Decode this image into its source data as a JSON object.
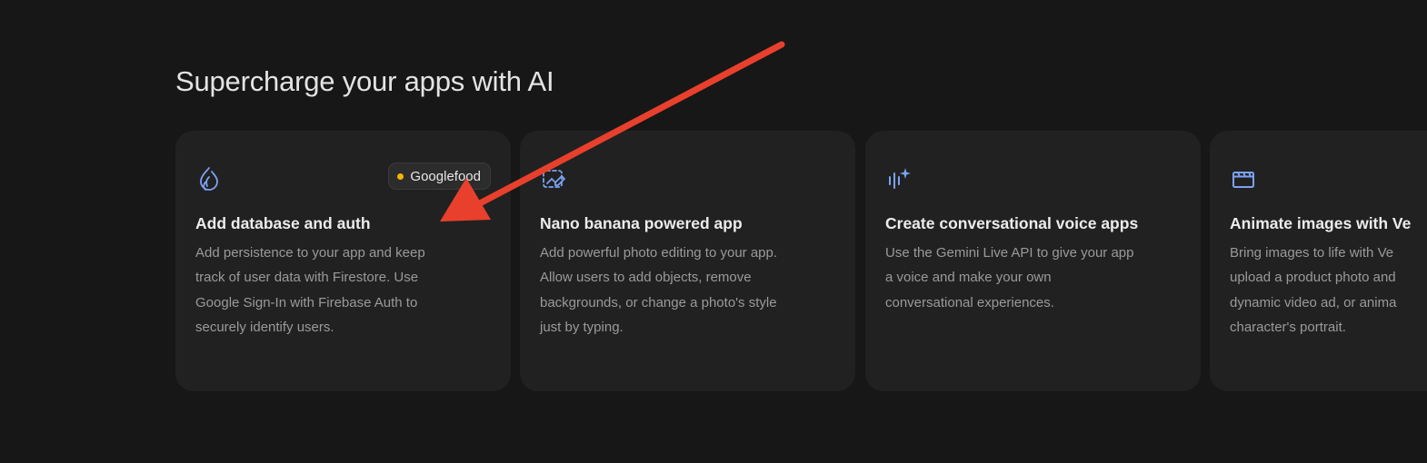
{
  "section": {
    "title": "Supercharge your apps with AI"
  },
  "cards": [
    {
      "icon": "firebase-flame-icon",
      "title": "Add database and auth",
      "desc": [
        "Add persistence to your app and keep",
        "track of user data with Firestore. Use",
        "Google Sign-In with Firebase Auth to",
        "securely identify users."
      ],
      "badge": "Googlefood"
    },
    {
      "icon": "photo-edit-icon",
      "title": "Nano banana powered app",
      "desc": [
        "Add powerful photo editing to your app.",
        "Allow users to add objects, remove",
        "backgrounds, or change a photo's style",
        "just by typing."
      ]
    },
    {
      "icon": "voice-sparkle-icon",
      "title": "Create conversational voice apps",
      "desc": [
        "Use the Gemini Live API to give your app",
        "a voice and make your own",
        "conversational experiences."
      ]
    },
    {
      "icon": "clapperboard-icon",
      "title": "Animate images with Ve",
      "desc": [
        "Bring images to life with Ve",
        "upload a product photo and",
        "dynamic video ad, or anima",
        "character's portrait."
      ]
    }
  ],
  "colors": {
    "background": "#171717",
    "card": "#212121",
    "icon_blue": "#7ba2f2",
    "annotation_arrow": "#e8402c",
    "badge_dot": "#f4b400"
  }
}
